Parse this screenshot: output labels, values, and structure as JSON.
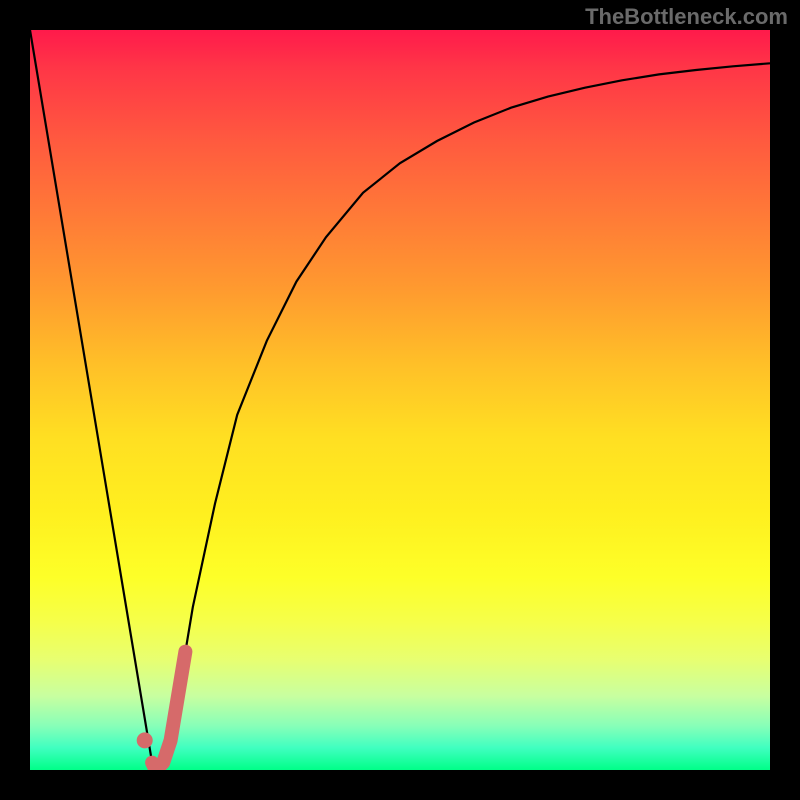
{
  "watermark": "TheBottleneck.com",
  "chart_data": {
    "type": "line",
    "title": "",
    "xlabel": "",
    "ylabel": "",
    "xlim": [
      0,
      100
    ],
    "ylim": [
      0,
      100
    ],
    "grid": false,
    "series": [
      {
        "name": "bottleneck-curve",
        "color": "#000000",
        "x": [
          0,
          2,
          4,
          6,
          8,
          10,
          12,
          14,
          16,
          16.5,
          17,
          18,
          19,
          20,
          22,
          25,
          28,
          32,
          36,
          40,
          45,
          50,
          55,
          60,
          65,
          70,
          75,
          80,
          85,
          90,
          95,
          100
        ],
        "y": [
          100,
          88,
          76,
          64,
          52,
          40,
          28,
          16,
          4,
          1,
          0,
          1,
          4,
          10,
          22,
          36,
          48,
          58,
          66,
          72,
          78,
          82,
          85,
          87.5,
          89.5,
          91,
          92.2,
          93.2,
          94,
          94.6,
          95.1,
          95.5
        ]
      },
      {
        "name": "highlight-marker",
        "color": "#d66a6a",
        "type": "scatter",
        "x": [
          15.5
        ],
        "y": [
          4
        ]
      },
      {
        "name": "highlight-segment",
        "color": "#d66a6a",
        "x": [
          16.5,
          17,
          18,
          19,
          20,
          21
        ],
        "y": [
          1,
          0,
          1,
          4,
          10,
          16
        ]
      }
    ],
    "gradient_stops": [
      {
        "pos": 0,
        "color": "#ff1a4b"
      },
      {
        "pos": 50,
        "color": "#ffdf22"
      },
      {
        "pos": 100,
        "color": "#00ff88"
      }
    ]
  }
}
